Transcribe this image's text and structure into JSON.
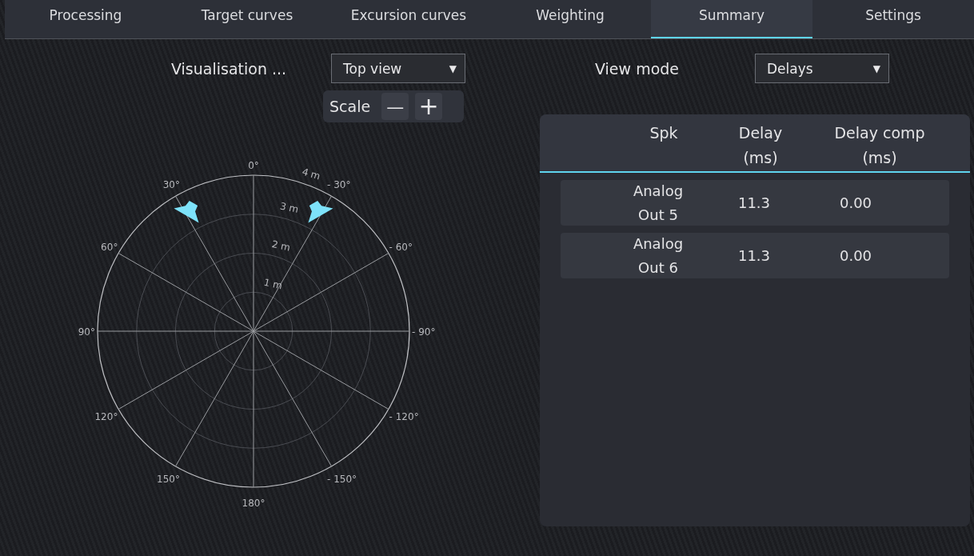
{
  "tabs": [
    {
      "label": "Processing",
      "selected": false
    },
    {
      "label": "Target curves",
      "selected": false
    },
    {
      "label": "Excursion curves",
      "selected": false
    },
    {
      "label": "Weighting",
      "selected": false
    },
    {
      "label": "Summary",
      "selected": true
    },
    {
      "label": "Settings",
      "selected": false
    }
  ],
  "visualisation": {
    "label": "Visualisation ...",
    "value": "Top view",
    "arrow": "▼"
  },
  "scale": {
    "label": "Scale",
    "minus": "—",
    "plus": "+"
  },
  "view_mode": {
    "label": "View mode",
    "value": "Delays",
    "arrow": "▼"
  },
  "polar": {
    "angle_labels": [
      "0°",
      "- 30°",
      "- 60°",
      "- 90°",
      "- 120°",
      "- 150°",
      "180°",
      "150°",
      "120°",
      "90°",
      "60°",
      "30°"
    ],
    "ring_labels": [
      "1 m",
      "2 m",
      "3 m",
      "4 m"
    ]
  },
  "table": {
    "columns": [
      "Spk",
      "Delay\n(ms)",
      "Delay comp\n(ms)"
    ],
    "rows": [
      {
        "spk": "Analog\nOut 5",
        "delay": "11.3",
        "comp": "0.00"
      },
      {
        "spk": "Analog\nOut 6",
        "delay": "11.3",
        "comp": "0.00"
      }
    ]
  }
}
